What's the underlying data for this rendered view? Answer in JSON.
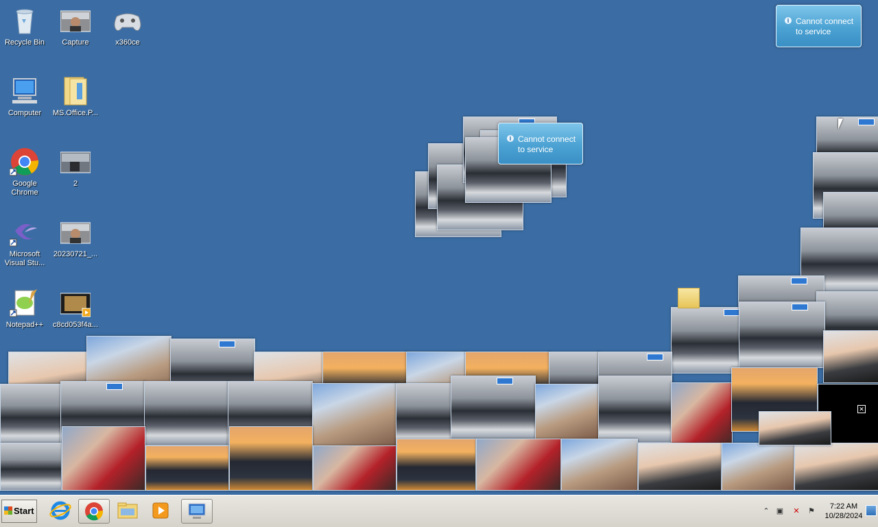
{
  "desktop": {
    "icons": [
      {
        "label": "Recycle Bin",
        "icon": "recycle-bin-icon"
      },
      {
        "label": "Capture",
        "icon": "image-thumbnail-icon"
      },
      {
        "label": "x360ce",
        "icon": "gamepad-icon"
      },
      {
        "label": "Computer",
        "icon": "computer-icon"
      },
      {
        "label": "MS.Office.P...",
        "icon": "folder-icon"
      },
      {
        "label": "Google Chrome",
        "icon": "chrome-icon"
      },
      {
        "label": "2",
        "icon": "image-thumbnail-icon"
      },
      {
        "label": "Microsoft Visual Stu...",
        "icon": "visual-studio-icon"
      },
      {
        "label": "20230721_...",
        "icon": "image-thumbnail-icon"
      },
      {
        "label": "Notepad++",
        "icon": "notepad-plus-plus-icon"
      },
      {
        "label": "c8cd053f4a...",
        "icon": "video-thumbnail-icon"
      }
    ]
  },
  "notifications": {
    "message": "Cannot connect to service"
  },
  "taskbar": {
    "start_label": "Start",
    "apps": [
      "internet-explorer-icon",
      "chrome-icon",
      "file-explorer-icon",
      "media-player-icon",
      "remote-desktop-icon"
    ],
    "clock_time": "7:22 AM",
    "clock_date": "10/28/2024"
  },
  "colors": {
    "desktop": "#3b6da4",
    "toast": "#4ba2d3",
    "taskbar": "#d6d3cb"
  }
}
